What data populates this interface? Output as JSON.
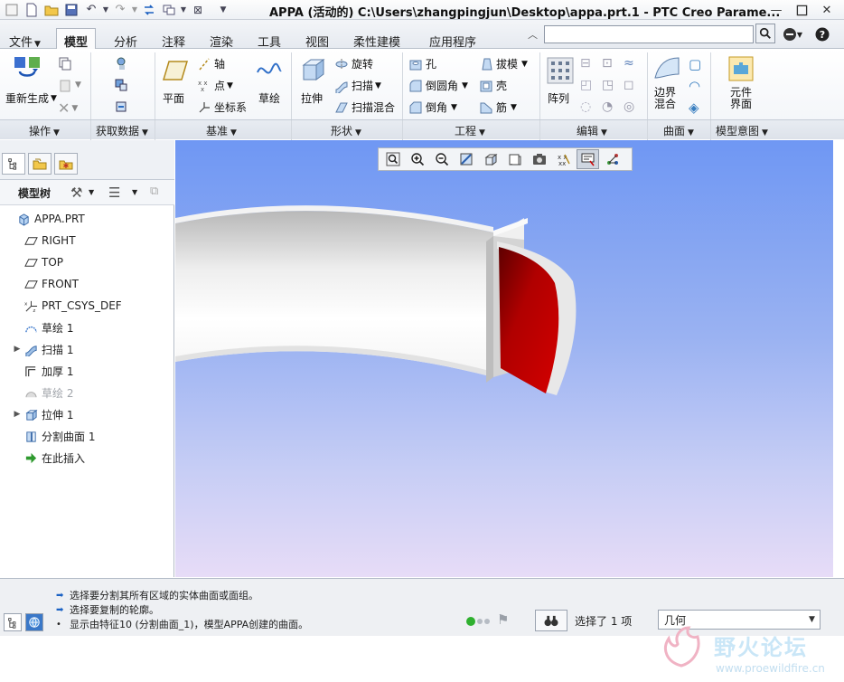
{
  "window": {
    "title": "APPA (活动的) C:\\Users\\zhangpingjun\\Desktop\\appa.prt.1 - PTC Creo Parame...",
    "controls": [
      "minimize-button",
      "maximize-button",
      "close-button"
    ]
  },
  "tabs": [
    {
      "label": "文件",
      "has_dropdown": true
    },
    {
      "label": "模型",
      "active": true
    },
    {
      "label": "分析"
    },
    {
      "label": "注释"
    },
    {
      "label": "渲染"
    },
    {
      "label": "工具"
    },
    {
      "label": "视图"
    },
    {
      "label": "柔性建模"
    },
    {
      "label": "应用程序"
    }
  ],
  "search": {
    "placeholder": ""
  },
  "ribbon": {
    "operations": {
      "regen": "重新生成"
    },
    "datum": {
      "plane": "平面",
      "axis": "轴",
      "point": "点",
      "csys": "坐标系",
      "sketch": "草绘"
    },
    "shapes": {
      "extrude": "拉伸",
      "revolve": "旋转",
      "sweep": "扫描",
      "swept_blend": "扫描混合"
    },
    "engineering": {
      "hole": "孔",
      "round": "倒圆角",
      "chamfer": "倒角",
      "draft": "拔模",
      "shell": "壳",
      "rib": "筋"
    },
    "editing": {
      "pattern": "阵列"
    },
    "surfaces": {
      "boundary_blend_line1": "边界",
      "boundary_blend_line2": "混合"
    },
    "model_intent": {
      "component_interface_line1": "元件",
      "component_interface_line2": "界面"
    },
    "groups": [
      {
        "label": "操作"
      },
      {
        "label": "获取数据"
      },
      {
        "label": "基准"
      },
      {
        "label": "形状"
      },
      {
        "label": "工程"
      },
      {
        "label": "编辑"
      },
      {
        "label": "曲面"
      },
      {
        "label": "模型意图"
      }
    ]
  },
  "model_tree": {
    "title": "模型树",
    "items": [
      {
        "label": "APPA.PRT",
        "icon": "part-icon",
        "expandable": false,
        "dimmed": false
      },
      {
        "label": "RIGHT",
        "icon": "datum-plane-icon",
        "expandable": false,
        "dimmed": false
      },
      {
        "label": "TOP",
        "icon": "datum-plane-icon",
        "expandable": false,
        "dimmed": false
      },
      {
        "label": "FRONT",
        "icon": "datum-plane-icon",
        "expandable": false,
        "dimmed": false
      },
      {
        "label": "PRT_CSYS_DEF",
        "icon": "csys-icon",
        "expandable": false,
        "dimmed": false
      },
      {
        "label": "草绘 1",
        "icon": "sketch-icon",
        "expandable": false,
        "dimmed": false
      },
      {
        "label": "扫描 1",
        "icon": "sweep-icon",
        "expandable": true,
        "dimmed": false
      },
      {
        "label": "加厚 1",
        "icon": "thicken-icon",
        "expandable": false,
        "dimmed": false
      },
      {
        "label": "草绘 2",
        "icon": "sketch-icon",
        "expandable": false,
        "dimmed": true
      },
      {
        "label": "拉伸 1",
        "icon": "extrude-icon",
        "expandable": true,
        "dimmed": false
      },
      {
        "label": "分割曲面 1",
        "icon": "split-surface-icon",
        "expandable": false,
        "dimmed": false
      },
      {
        "label": "在此插入",
        "icon": "insert-here-icon",
        "expandable": false,
        "dimmed": false
      }
    ]
  },
  "messages": [
    "选择要分割其所有区域的实体曲面或面组。",
    "选择要复制的轮廓。",
    "显示由特征10 (分割曲面_1)，模型APPA创建的曲面。"
  ],
  "status": {
    "selection": "选择了 1 项",
    "filter": "几何"
  },
  "watermark": {
    "brand": "野火论坛",
    "url": "www.proewildfire.cn"
  },
  "colors": {
    "viewport_top": "#6f97f3",
    "viewport_bottom": "#e7dcf7",
    "split_surface": "#c40000"
  }
}
